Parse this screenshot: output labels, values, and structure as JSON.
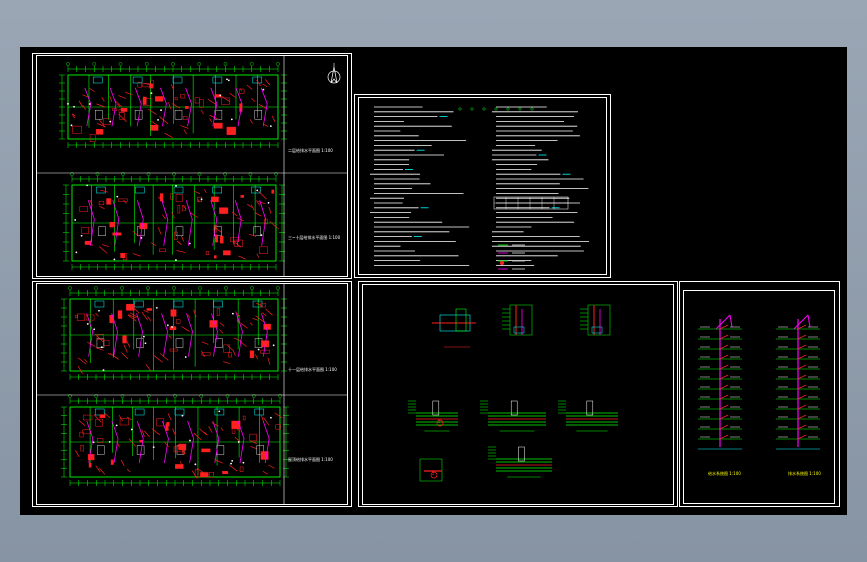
{
  "drawing": {
    "background": "#000000",
    "frame_color": "#ffffff",
    "colors": {
      "wall": "#00ff00",
      "furniture": "#ff2020",
      "pipe": "#ff00ff",
      "cyan": "#00ffff",
      "white": "#ffffff"
    },
    "north_symbol": "north-arrow-icon",
    "plan_titles": [
      "二层给排水平面图  1:100",
      "三~十层给排水平面图  1:100",
      "十一层给排水平面图  1:100",
      "屋顶给排水平面图  1:100"
    ],
    "detail_labels": [
      "1",
      "2"
    ],
    "system_titles": [
      "给水系统图  1:100",
      "排水系统图  1:100"
    ]
  }
}
